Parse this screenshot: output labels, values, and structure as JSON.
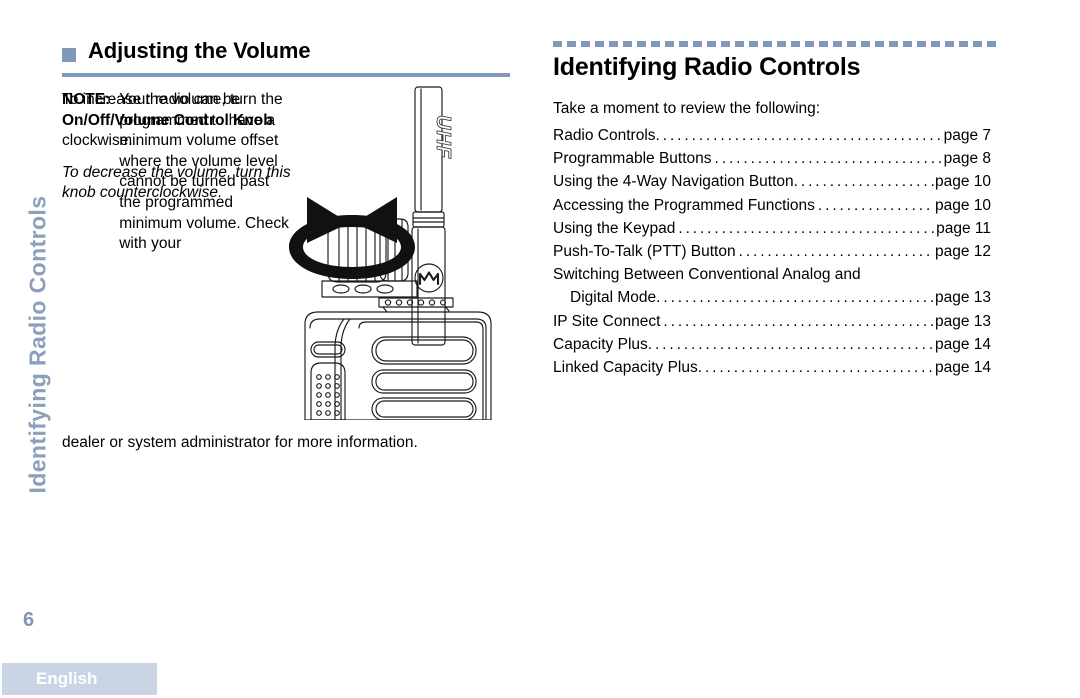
{
  "sidebar": {
    "chapter_label": "Identifying Radio Controls",
    "page_number": "6"
  },
  "footer": {
    "language": "English"
  },
  "left_section": {
    "heading": "Adjusting the Volume",
    "bullet_icon": "square-bullet-icon",
    "paragraph_increase": {
      "part1": "To increase the volume, turn the ",
      "bold1": "On/Off/Volume Control Knob",
      "part2": " clockwise."
    },
    "paragraph_decrease": "To decrease the volume, turn this knob counterclockwise.",
    "note": {
      "label": "NOTE:",
      "text": "Your radio can be programmed to have a minimum volume offset where the volume level cannot be turned past the programmed minimum volume. Check with your",
      "tail": "dealer or system administrator for more information."
    },
    "illustration": {
      "name": "radio-volume-knob-illustration",
      "antenna_label": "UHF",
      "brand_mark": "motorola-m-logo"
    }
  },
  "right_section": {
    "heading": "Identifying Radio Controls",
    "intro": "Take a moment to review the following:",
    "toc": [
      {
        "title": "Radio Controls",
        "page": "page 7",
        "indented": false,
        "nogap": true
      },
      {
        "title": "Programmable Buttons",
        "page": "page 8",
        "indented": false,
        "nogap": false
      },
      {
        "title": "Using the 4-Way Navigation Button",
        "page": "page 10",
        "indented": false,
        "nogap": true
      },
      {
        "title": "Accessing the Programmed Functions",
        "page": "page 10",
        "indented": false,
        "nogap": false
      },
      {
        "title": "Using the Keypad",
        "page": "page 11",
        "indented": false,
        "nogap": false
      },
      {
        "title": "Push-To-Talk (PTT) Button",
        "page": "page 12",
        "indented": false,
        "nogap": false
      },
      {
        "title": "Switching Between Conventional Analog and",
        "page": "",
        "indented": false,
        "nogap": false,
        "wrap": true
      },
      {
        "title": "Digital Mode",
        "page": "page 13",
        "indented": true,
        "nogap": true
      },
      {
        "title": "IP Site Connect",
        "page": "page 13",
        "indented": false,
        "nogap": false
      },
      {
        "title": "Capacity Plus",
        "page": "page 14",
        "indented": false,
        "nogap": true
      },
      {
        "title": "Linked Capacity Plus",
        "page": "page 14",
        "indented": false,
        "nogap": true
      }
    ]
  },
  "colors": {
    "accent_blue": "#8099b8",
    "sidebar_text": "#8c9fbb",
    "footer_bar": "#c9d5e4"
  }
}
